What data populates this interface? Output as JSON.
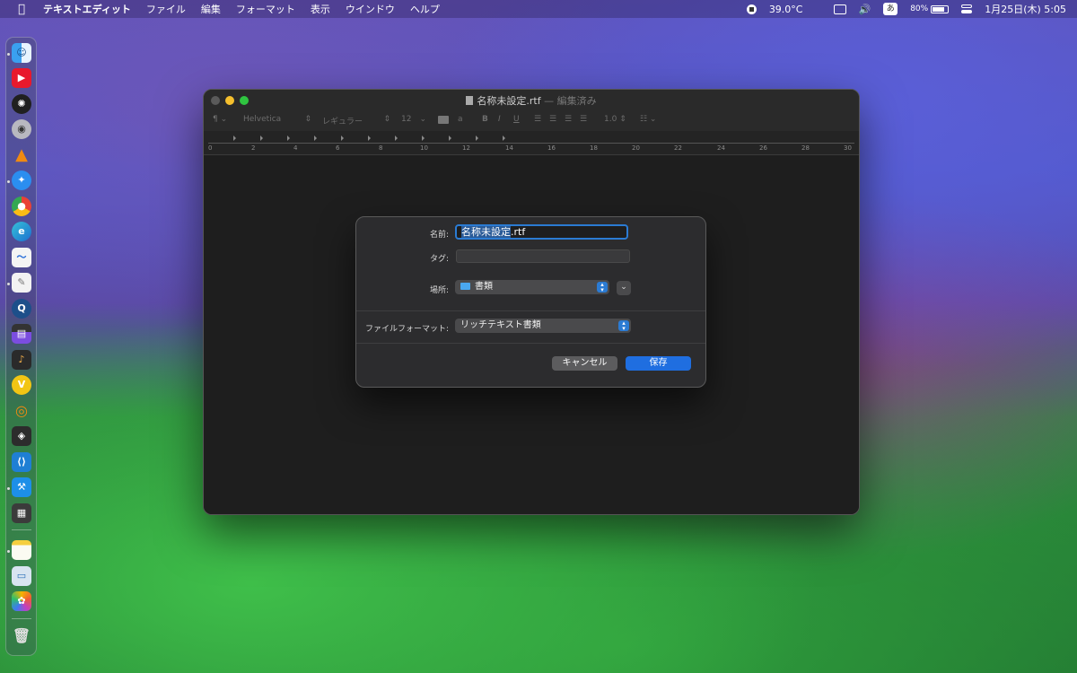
{
  "menubar": {
    "app_name": "テキストエディット",
    "items": [
      "ファイル",
      "編集",
      "フォーマット",
      "表示",
      "ウインドウ",
      "ヘルプ"
    ],
    "temperature": "39.0°C",
    "input_method": "あ",
    "battery_percent": "80%",
    "battery_level": 0.8,
    "clock": "1月25日(木)  5:05"
  },
  "dock": {
    "apps": [
      "finder-icon",
      "youtube-icon",
      "chatgpt-icon",
      "podcast-icon",
      "vlc-icon",
      "safari-icon",
      "chrome-icon",
      "edge-icon",
      "freeform-icon",
      "textedit-icon",
      "quicktime-icon",
      "final-cut-icon",
      "logic-icon",
      "vectorize-icon",
      "blender-icon",
      "unity-icon",
      "vscode-icon",
      "xcode-icon",
      "calculator-icon",
      "notes-icon",
      "preview-icon",
      "photos-icon",
      "trash-icon"
    ]
  },
  "window": {
    "title": "名称未設定.rtf",
    "title_suffix": "— 編集済み",
    "toolbar": {
      "paragraph": "¶",
      "font_family": "Helvetica",
      "font_style": "レギュラー",
      "font_size": "12",
      "bold": "B",
      "italic": "I",
      "underline": "U",
      "line_spacing": "1.0"
    },
    "ruler_numbers": [
      "0",
      "2",
      "4",
      "6",
      "8",
      "10",
      "12",
      "14",
      "16",
      "18",
      "20",
      "22",
      "24",
      "26",
      "28",
      "30"
    ]
  },
  "save_dialog": {
    "name_label": "名前:",
    "name_selected": "名称未設定",
    "name_ext": ".rtf",
    "tags_label": "タグ:",
    "location_label": "場所:",
    "location_value": "書類",
    "format_label": "ファイルフォーマット:",
    "format_value": "リッチテキスト書類",
    "cancel_label": "キャンセル",
    "save_label": "保存"
  }
}
